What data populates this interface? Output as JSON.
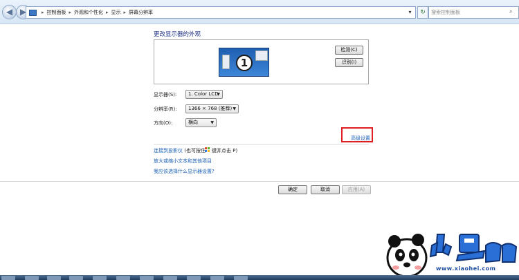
{
  "address_bar": {
    "crumbs": [
      "控制面板",
      "外观和个性化",
      "显示",
      "屏幕分辨率"
    ],
    "search_placeholder": "搜索控制面板"
  },
  "page": {
    "title": "更改显示器的外观",
    "monitor_number": "1",
    "detect_label": "检测(C)",
    "identify_label": "识别(I)",
    "display_label": "显示器(S):",
    "display_value": "1. Color LCD",
    "resolution_label": "分辨率(R):",
    "resolution_value": "1366 × 768 (推荐)",
    "orientation_label": "方向(O):",
    "orientation_value": "横向",
    "advanced_link": "高级设置",
    "projector_link": "连接到投影仪",
    "projector_hint_pre": "(也可按住",
    "projector_hint_post": "键并点击 P)",
    "text_size_link": "放大或缩小文本和其他项目",
    "which_link": "我应该选择什么显示器设置?"
  },
  "footer": {
    "ok_label": "确定",
    "cancel_label": "取消",
    "apply_label": "应用(A)"
  },
  "watermark": {
    "site": "www.xiaohei.com"
  },
  "colors": {
    "link": "#1a5fb4",
    "title": "#1e3287",
    "highlight": "#e02020"
  }
}
